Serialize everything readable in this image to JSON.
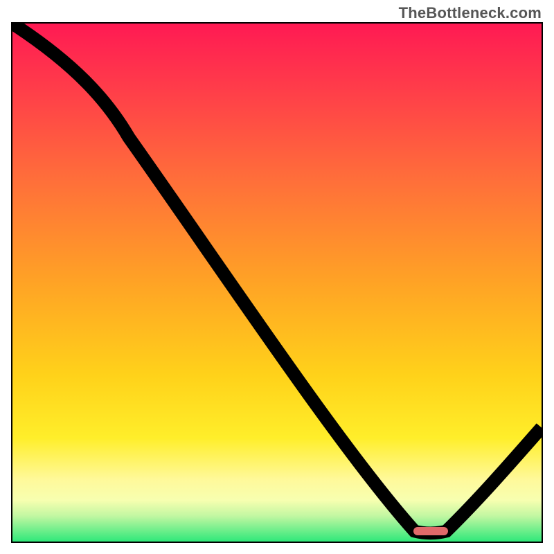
{
  "attribution": "TheBottleneck.com",
  "chart_data": {
    "type": "line",
    "title": "",
    "xlabel": "",
    "ylabel": "",
    "xlim": [
      0,
      100
    ],
    "ylim": [
      0,
      100
    ],
    "x": [
      0,
      22,
      76,
      82,
      100
    ],
    "values": [
      100,
      78,
      2,
      2,
      22
    ],
    "optimum_marker": {
      "x": 79,
      "y": 2,
      "color": "#e06a6a"
    },
    "gradient_stops": [
      {
        "pct": 0,
        "color": "#ff1a53"
      },
      {
        "pct": 12,
        "color": "#ff3b4a"
      },
      {
        "pct": 30,
        "color": "#ff6e3a"
      },
      {
        "pct": 50,
        "color": "#ffa325"
      },
      {
        "pct": 68,
        "color": "#ffd21a"
      },
      {
        "pct": 80,
        "color": "#ffee2a"
      },
      {
        "pct": 88,
        "color": "#fff99a"
      },
      {
        "pct": 92,
        "color": "#f7ffb0"
      },
      {
        "pct": 95,
        "color": "#c3f7a2"
      },
      {
        "pct": 100,
        "color": "#2fe87a"
      }
    ]
  }
}
